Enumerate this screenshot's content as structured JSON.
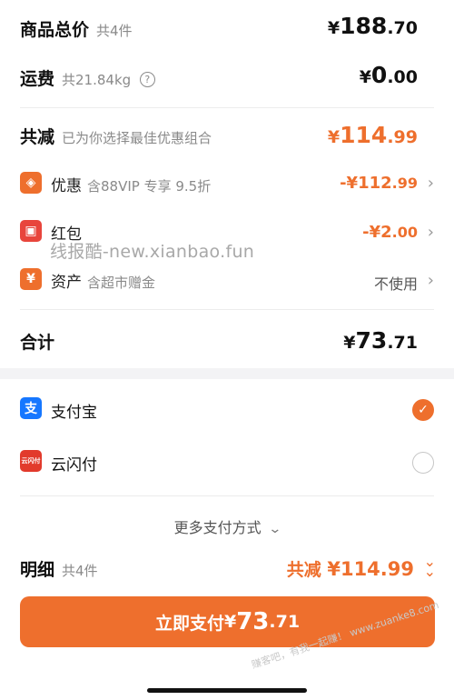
{
  "summary": {
    "goods_total": {
      "label": "商品总价",
      "sub": "共4件",
      "currency": "¥",
      "int": "188",
      "dec": ".70"
    },
    "shipping": {
      "label": "运费",
      "sub": "共21.84kg",
      "help_icon": "question-circle-icon",
      "currency": "¥",
      "int": "0",
      "dec": ".00"
    },
    "reduction": {
      "label": "共减",
      "sub": "已为你选择最佳优惠组合",
      "currency": "¥",
      "int": "114",
      "dec": ".99"
    },
    "discounts": [
      {
        "icon": "tag-icon",
        "icon_glyph": "◈",
        "icon_color": "#ee6f2d",
        "label": "优惠",
        "sub": "含88VIP 专享 9.5折",
        "sign": "-¥",
        "int": "112",
        "dec": ".99"
      },
      {
        "icon": "red-packet-icon",
        "icon_glyph": "▣",
        "icon_color": "#e8453c",
        "label": "红包",
        "sub": "",
        "sign": "-¥",
        "int": "2",
        "dec": ".00"
      },
      {
        "icon": "yen-icon",
        "icon_glyph": "¥",
        "icon_color": "#ee6f2d",
        "label": "资产",
        "sub": "含超市赠金",
        "value": "不使用"
      }
    ],
    "total": {
      "label": "合计",
      "currency": "¥",
      "int": "73",
      "dec": ".71"
    }
  },
  "watermark": "线报酷-new.xianbao.fun",
  "payment": {
    "methods": [
      {
        "name": "支付宝",
        "icon": "alipay-icon",
        "icon_glyph": "支",
        "icon_color": "#1677ff",
        "selected": true
      },
      {
        "name": "云闪付",
        "icon": "unionpay-icon",
        "icon_glyph": "云闪付",
        "icon_color": "#e23a2c",
        "selected": false
      }
    ],
    "more_label": "更多支付方式"
  },
  "detail": {
    "label": "明细",
    "sub": "共4件",
    "reduction_label": "共减",
    "reduction_value": "¥114.99"
  },
  "pay_button": {
    "prefix": "立即支付 ",
    "currency": "¥",
    "int": "73",
    "dec": ".71"
  },
  "corner_stamp": "赚客吧，有我一起赚！ www.zuanke8.com",
  "colors": {
    "accent": "#ee6f2d",
    "alipay": "#1677ff",
    "unionpay": "#e23a2c"
  }
}
